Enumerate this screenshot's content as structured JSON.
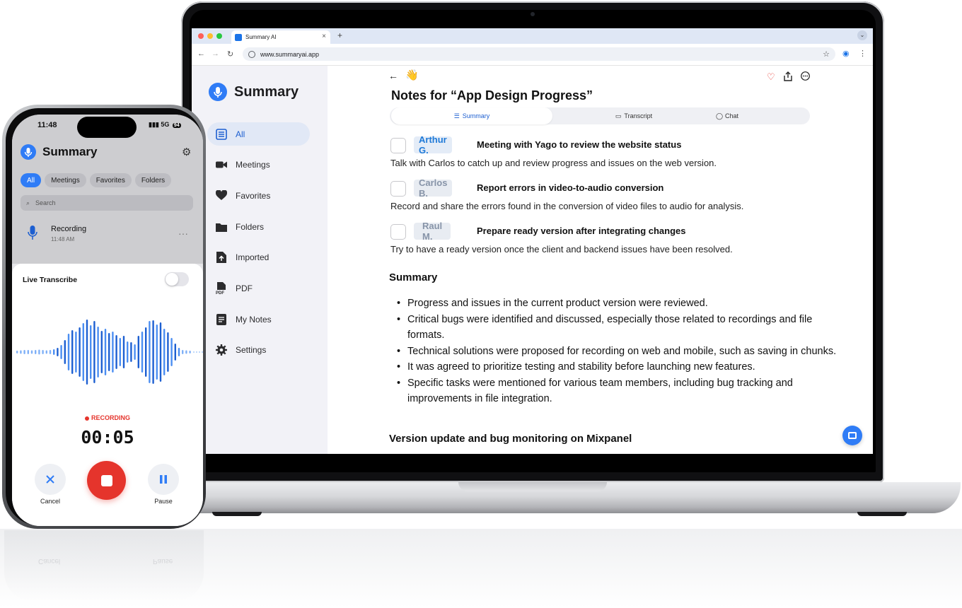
{
  "browser": {
    "tab_title": "Summary AI",
    "tab_close": "×",
    "new_tab": "+",
    "url": "www.summaryai.app",
    "icons": [
      "back-icon",
      "forward-icon",
      "reload-icon",
      "star-icon",
      "profile-icon",
      "more-icon"
    ]
  },
  "web": {
    "brand": "Summary",
    "sidebar": [
      {
        "label": "All",
        "icon": "list-icon",
        "active": true
      },
      {
        "label": "Meetings",
        "icon": "video-icon"
      },
      {
        "label": "Favorites",
        "icon": "heart-icon"
      },
      {
        "label": "Folders",
        "icon": "folder-icon"
      },
      {
        "label": "Imported",
        "icon": "import-icon"
      },
      {
        "label": "PDF",
        "icon": "pdf-icon"
      },
      {
        "label": "My Notes",
        "icon": "notes-icon"
      },
      {
        "label": "Settings",
        "icon": "gear-icon"
      }
    ],
    "wave_emoji": "👋",
    "back": "←",
    "note_title": "Notes for “App Design Progress”",
    "tabs": [
      {
        "label": "Summary",
        "icon": "☰",
        "active": true
      },
      {
        "label": "Transcript",
        "icon": "▭"
      },
      {
        "label": "Chat",
        "icon": "◯"
      }
    ],
    "tasks": [
      {
        "assignee": "Arthur G.",
        "title": "Meeting with Yago to review the website status",
        "description": "Talk with Carlos to catch up and review progress and issues on the web version."
      },
      {
        "assignee": "Carlos B.",
        "title": "Report errors in video-to-audio conversion",
        "description": "Record and share the errors found in the conversion of video files to audio for analysis."
      },
      {
        "assignee": "Raul M.",
        "title": "Prepare ready version after integrating changes",
        "description": "Try to have a ready version once the client and backend issues have been resolved."
      }
    ],
    "summary_heading": "Summary",
    "summary_bullets": [
      "Progress and issues in the current product version were reviewed.",
      "Critical bugs were identified and discussed, especially those related to recordings and file formats.",
      "Technical solutions were proposed for recording on web and mobile, such as saving in chunks.",
      "It was agreed to prioritize testing and stability before launching new features.",
      "Specific tasks were mentioned for various team members, including bug tracking and improvements in file integration."
    ],
    "next_heading": "Version update and bug monitoring on Mixpanel",
    "accent": "#2f7cf6",
    "heart_color": "#e5342c"
  },
  "phone": {
    "time": "11:48",
    "signal": "5G",
    "battery": "94",
    "title": "Summary",
    "chips": [
      {
        "label": "All",
        "active": true
      },
      {
        "label": "Meetings"
      },
      {
        "label": "Favorites"
      },
      {
        "label": "Folders"
      }
    ],
    "search_placeholder": "Search",
    "recording_item": {
      "title": "Recording",
      "time": "11:48 AM",
      "more": "···"
    },
    "live_transcribe": "Live Transcribe",
    "live_transcribe_on": false,
    "recording_label": "RECORDING",
    "timer": "00:05",
    "cancel": "Cancel",
    "pause": "Pause",
    "record_color": "#e5342c"
  }
}
